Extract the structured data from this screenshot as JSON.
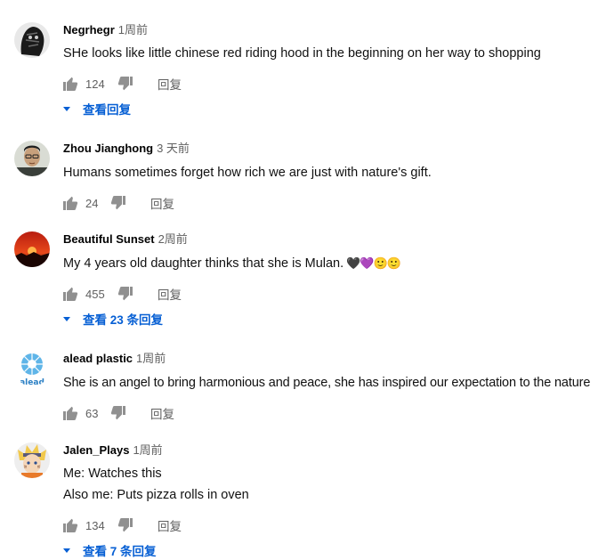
{
  "comments": [
    {
      "author": "Negrhegr",
      "time": "1周前",
      "lines": [
        "SHe looks like little chinese red riding hood in the beginning on her way to shopping"
      ],
      "likes": "124",
      "reply_label": "回复",
      "view_replies": "查看回复",
      "avatar_icon": "dark-silhouette-avatar"
    },
    {
      "author": "Zhou Jianghong",
      "time": "3 天前",
      "lines": [
        "Humans sometimes forget how rich we are just with nature's gift."
      ],
      "likes": "24",
      "reply_label": "回复",
      "view_replies": "",
      "avatar_icon": "man-glasses-avatar"
    },
    {
      "author": "Beautiful Sunset",
      "time": "2周前",
      "lines": [
        "My 4 years old daughter thinks that she is Mulan."
      ],
      "emoji": "🖤💜🙂🙂",
      "likes": "455",
      "reply_label": "回复",
      "view_replies": "查看 23 条回复",
      "avatar_icon": "sunset-avatar"
    },
    {
      "author": "alead plastic",
      "time": "1周前",
      "lines": [
        "She is an angel to bring harmonious and peace, she has inspired our expectation to the nature"
      ],
      "likes": "63",
      "reply_label": "回复",
      "view_replies": "",
      "avatar_icon": "alead-logo-avatar"
    },
    {
      "author": "Jalen_Plays",
      "time": "1周前",
      "lines": [
        "Me: Watches this",
        "Also me: Puts pizza rolls in oven"
      ],
      "likes": "134",
      "reply_label": "回复",
      "view_replies": "查看 7 条回复",
      "avatar_icon": "anime-character-avatar"
    }
  ],
  "colors": {
    "link": "#065fd4",
    "secondary_text": "#606060",
    "icon": "#909090"
  }
}
